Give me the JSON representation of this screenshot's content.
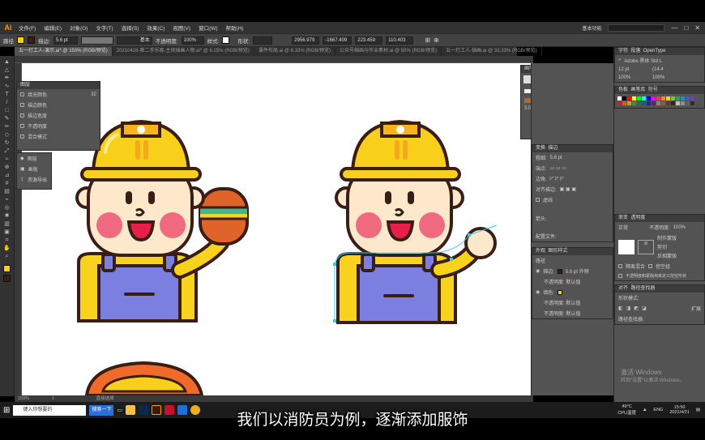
{
  "menubar": {
    "logo": "Ai",
    "items": [
      "文件(F)",
      "编辑(E)",
      "对象(O)",
      "文字(T)",
      "选择(S)",
      "效果(C)",
      "视图(V)",
      "窗口(W)",
      "帮助(H)"
    ],
    "workspace": "基本功能"
  },
  "control_bar": {
    "path_label": "路径",
    "stroke_label": "描边:",
    "stroke_value": "5.6 pt",
    "stroke_style": "基本",
    "opacity_label": "不透明度:",
    "opacity_value": "100%",
    "style_label": "样式:",
    "shape_label": "形状:",
    "x_value": "2956.979",
    "y_value": "-1667.409",
    "w_value": "223.459",
    "h_value": "110.403"
  },
  "doc_tabs": [
    "五一打工人-演示.ai* @ 150% (RGB/预览)",
    "20210428-第二手乐观-主体插画人物.ai* @ 6.25% (RGB/预览)",
    "课件布局.ai @ 8.33% (RGB/预览)",
    "公众号插画与作业素材.ai @ 50% (RGB/预览)",
    "五一打工人-插画.ai @ 33.33% (RGB/预览)"
  ],
  "appearance_panel": {
    "title": "图层",
    "rows": [
      "填充颜色",
      "描边颜色",
      "描边宽度",
      "不透明度",
      "混合模式"
    ],
    "value": "32"
  },
  "small_menu": {
    "items": [
      "图层",
      "画板",
      "资源导出"
    ]
  },
  "brush_panel": {
    "tabs": [
      "画笔",
      "符号"
    ],
    "basic": "基本",
    "size": "3.00"
  },
  "stroke_panel": {
    "tabs": [
      "变换",
      "描边"
    ],
    "weight_label": "粗细:",
    "weight_value": "5.6 pt",
    "cap_label": "端点:",
    "corner_label": "边角:",
    "align_label": "对齐描边:",
    "dashed_label": "虚线",
    "arrow_label": "箭头:",
    "profile_label": "配置文件:"
  },
  "appearance2": {
    "tabs": [
      "外观",
      "图形样式"
    ],
    "path_label": "路径",
    "stroke_label": "描边:",
    "stroke_value": "5.6 pt 外侧",
    "opacity_label": "不透明度: 默认值",
    "fill_label": "填色:",
    "opacity2": "不透明度: 默认值",
    "opacity3": "不透明度: 默认值"
  },
  "char_panel": {
    "tabs": [
      "字符",
      "段落",
      "OpenType"
    ],
    "font": "Adobe 黑体 Std L",
    "size": "12 pt",
    "leading": "(14.4",
    "tracking": "100%",
    "scale": "100%"
  },
  "swatch_panel": {
    "tabs": [
      "色板",
      "画笔库",
      "符号"
    ]
  },
  "transparency": {
    "tabs": [
      "渐变",
      "透明度"
    ],
    "mode": "正常",
    "opacity_label": "不透明度:",
    "opacity_value": "100%",
    "make_mask": "制作蒙版",
    "clip": "剪切",
    "invert": "反相蒙版",
    "opt1": "隔离混合",
    "opt2": "挖空组",
    "opt3": "不透明度和蒙版用来定义挖空形状"
  },
  "pathfinder": {
    "tabs": [
      "对齐",
      "路径查找器"
    ],
    "shape_modes": "形状模式:",
    "expand": "扩展",
    "pathfinders": "路径查找器:"
  },
  "statusbar": {
    "zoom": "150%",
    "page": "1",
    "tool": "直接选择"
  },
  "taskbar": {
    "search_placeholder": "键入你想要的",
    "search_btn": "搜索一下",
    "temp": "49°C",
    "temp_label": "CPU温度",
    "lang": "ENG",
    "time": "15:50",
    "date": "2021/4/21"
  },
  "watermark": {
    "line1": "激活 Windows",
    "line2": "转到\"设置\"以激活 Windows。"
  },
  "subtitle": "我们以消防员为例，逐渐添加服饰",
  "colors": {
    "helmet": "#f8cf1a",
    "outline": "#3a1d14",
    "skin": "#fde8cc",
    "cheek": "#f06a7f",
    "shirt": "#f8d31e",
    "overall": "#7b7fe0",
    "burger": "#e0632a"
  }
}
